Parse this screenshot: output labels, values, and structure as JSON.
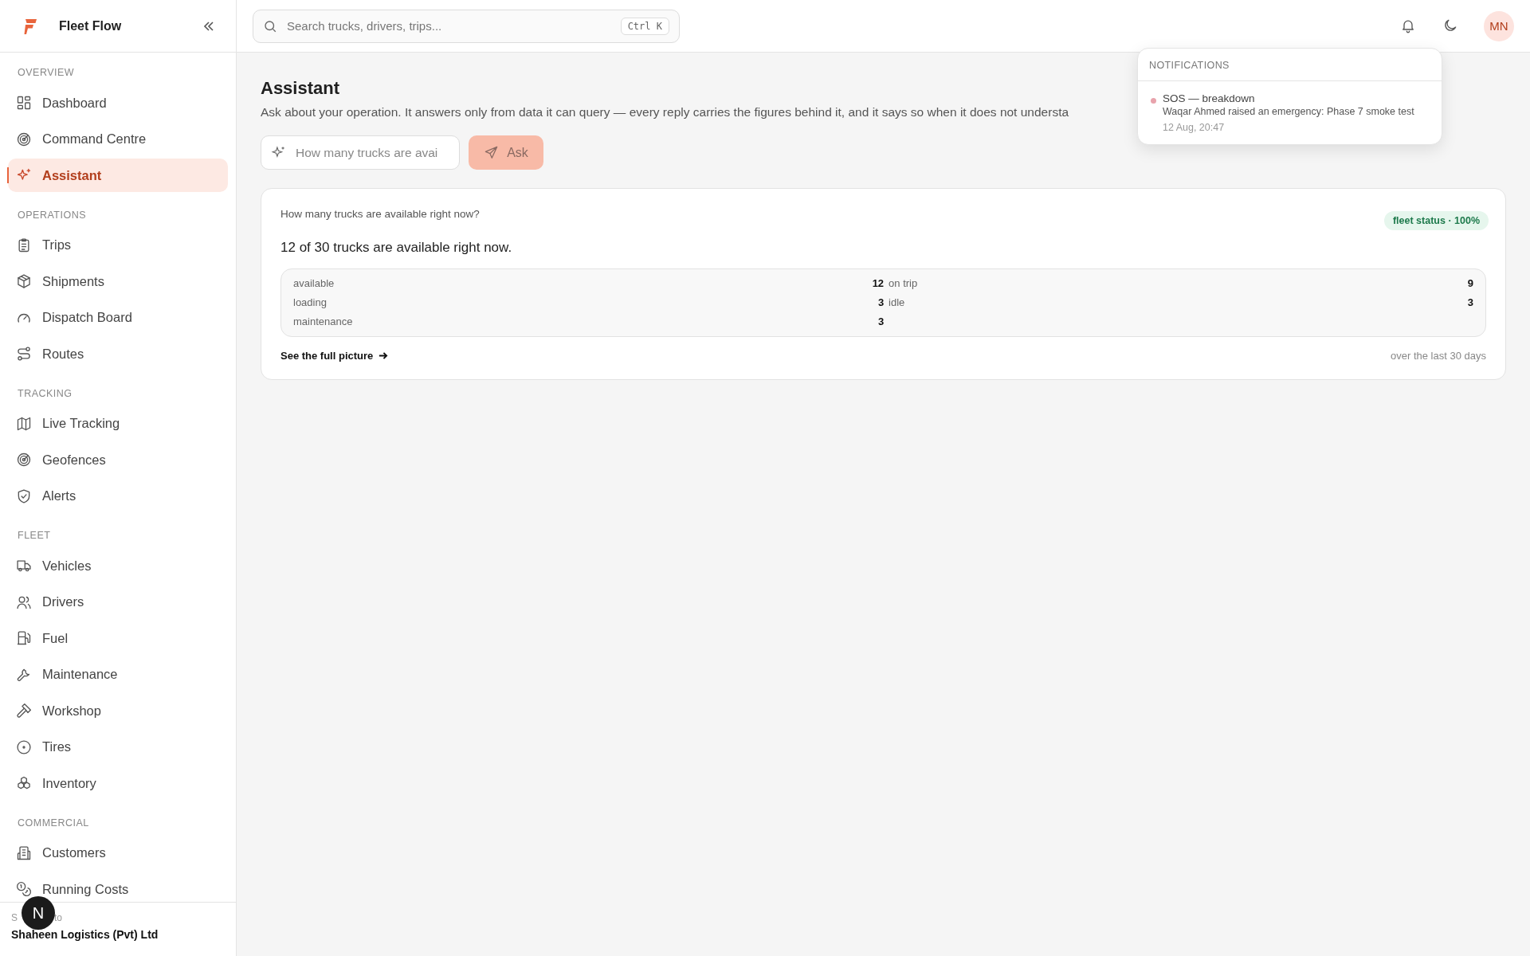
{
  "brand": {
    "name": "Fleet Flow"
  },
  "sidebar": {
    "sections": [
      {
        "label": "OVERVIEW",
        "items": [
          {
            "label": "Dashboard",
            "selected": false
          },
          {
            "label": "Command Centre",
            "selected": false
          },
          {
            "label": "Assistant",
            "selected": true
          }
        ]
      },
      {
        "label": "OPERATIONS",
        "items": [
          {
            "label": "Trips",
            "selected": false
          },
          {
            "label": "Shipments",
            "selected": false
          },
          {
            "label": "Dispatch Board",
            "selected": false
          },
          {
            "label": "Routes",
            "selected": false
          }
        ]
      },
      {
        "label": "TRACKING",
        "items": [
          {
            "label": "Live Tracking",
            "selected": false
          },
          {
            "label": "Geofences",
            "selected": false
          },
          {
            "label": "Alerts",
            "selected": false
          }
        ]
      },
      {
        "label": "FLEET",
        "items": [
          {
            "label": "Vehicles",
            "selected": false
          },
          {
            "label": "Drivers",
            "selected": false
          },
          {
            "label": "Fuel",
            "selected": false
          },
          {
            "label": "Maintenance",
            "selected": false
          },
          {
            "label": "Workshop",
            "selected": false
          },
          {
            "label": "Tires",
            "selected": false
          },
          {
            "label": "Inventory",
            "selected": false
          }
        ]
      },
      {
        "label": "COMMERCIAL",
        "items": [
          {
            "label": "Customers",
            "selected": false
          },
          {
            "label": "Running Costs",
            "selected": false
          }
        ]
      }
    ],
    "footer": {
      "label_parts": [
        "S",
        "to"
      ],
      "organisation": "Shaheen Logistics (Pvt) Ltd"
    }
  },
  "dev_badge": {
    "label": "N"
  },
  "topbar": {
    "search": {
      "placeholder": "Search trucks, drivers, trips...",
      "shortcut": "Ctrl K"
    },
    "avatar": "MN"
  },
  "notifications": {
    "title": "NOTIFICATIONS",
    "items": [
      {
        "title": "SOS — breakdown",
        "body": "Waqar Ahmed raised an emergency: Phase 7 smoke test",
        "time": "12 Aug, 20:47",
        "color": "#e8a3ac"
      }
    ]
  },
  "page": {
    "title": "Assistant",
    "description": "Ask about your operation. It answers only from data it can query — every reply carries the figures behind it, and it says so when it does not understa",
    "ask": {
      "placeholder": "How many trucks are avai",
      "button": "Ask",
      "disabled": true
    },
    "answer": {
      "question": "How many trucks are available right now?",
      "badge": "fleet status · 100%",
      "answer": "12 of 30 trucks are available right now.",
      "stats": [
        {
          "label": "available",
          "value": "12"
        },
        {
          "label": "on trip",
          "value": "9"
        },
        {
          "label": "loading",
          "value": "3"
        },
        {
          "label": "idle",
          "value": "3"
        },
        {
          "label": "maintenance",
          "value": "3"
        }
      ],
      "link": "See the full picture",
      "note": "over the last 30 days"
    }
  }
}
